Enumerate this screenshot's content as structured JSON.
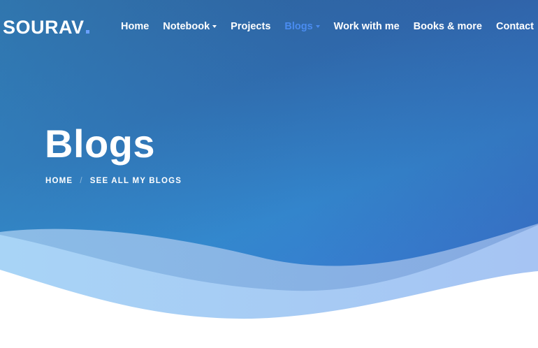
{
  "brand": {
    "name": "SOURAV",
    "dot_color": "#6aa0ff"
  },
  "nav": {
    "items": [
      {
        "label": "Home",
        "dropdown": false,
        "active": false
      },
      {
        "label": "Notebook",
        "dropdown": true,
        "active": false
      },
      {
        "label": "Projects",
        "dropdown": false,
        "active": false
      },
      {
        "label": "Blogs",
        "dropdown": true,
        "active": true
      },
      {
        "label": "Work with me",
        "dropdown": false,
        "active": false
      },
      {
        "label": "Books & more",
        "dropdown": false,
        "active": false
      },
      {
        "label": "Contact",
        "dropdown": false,
        "active": false
      }
    ]
  },
  "hero": {
    "title": "Blogs",
    "breadcrumb": {
      "home": "HOME",
      "separator": "/",
      "current": "SEE ALL MY BLOGS"
    }
  },
  "colors": {
    "hero_top": "#2e5f98",
    "hero_bottom": "#3385cc",
    "active_link": "#4a8cf0",
    "wave_light": "#a9d2f5",
    "wave_mid": "#8fb4e6",
    "background": "#ffffff"
  }
}
